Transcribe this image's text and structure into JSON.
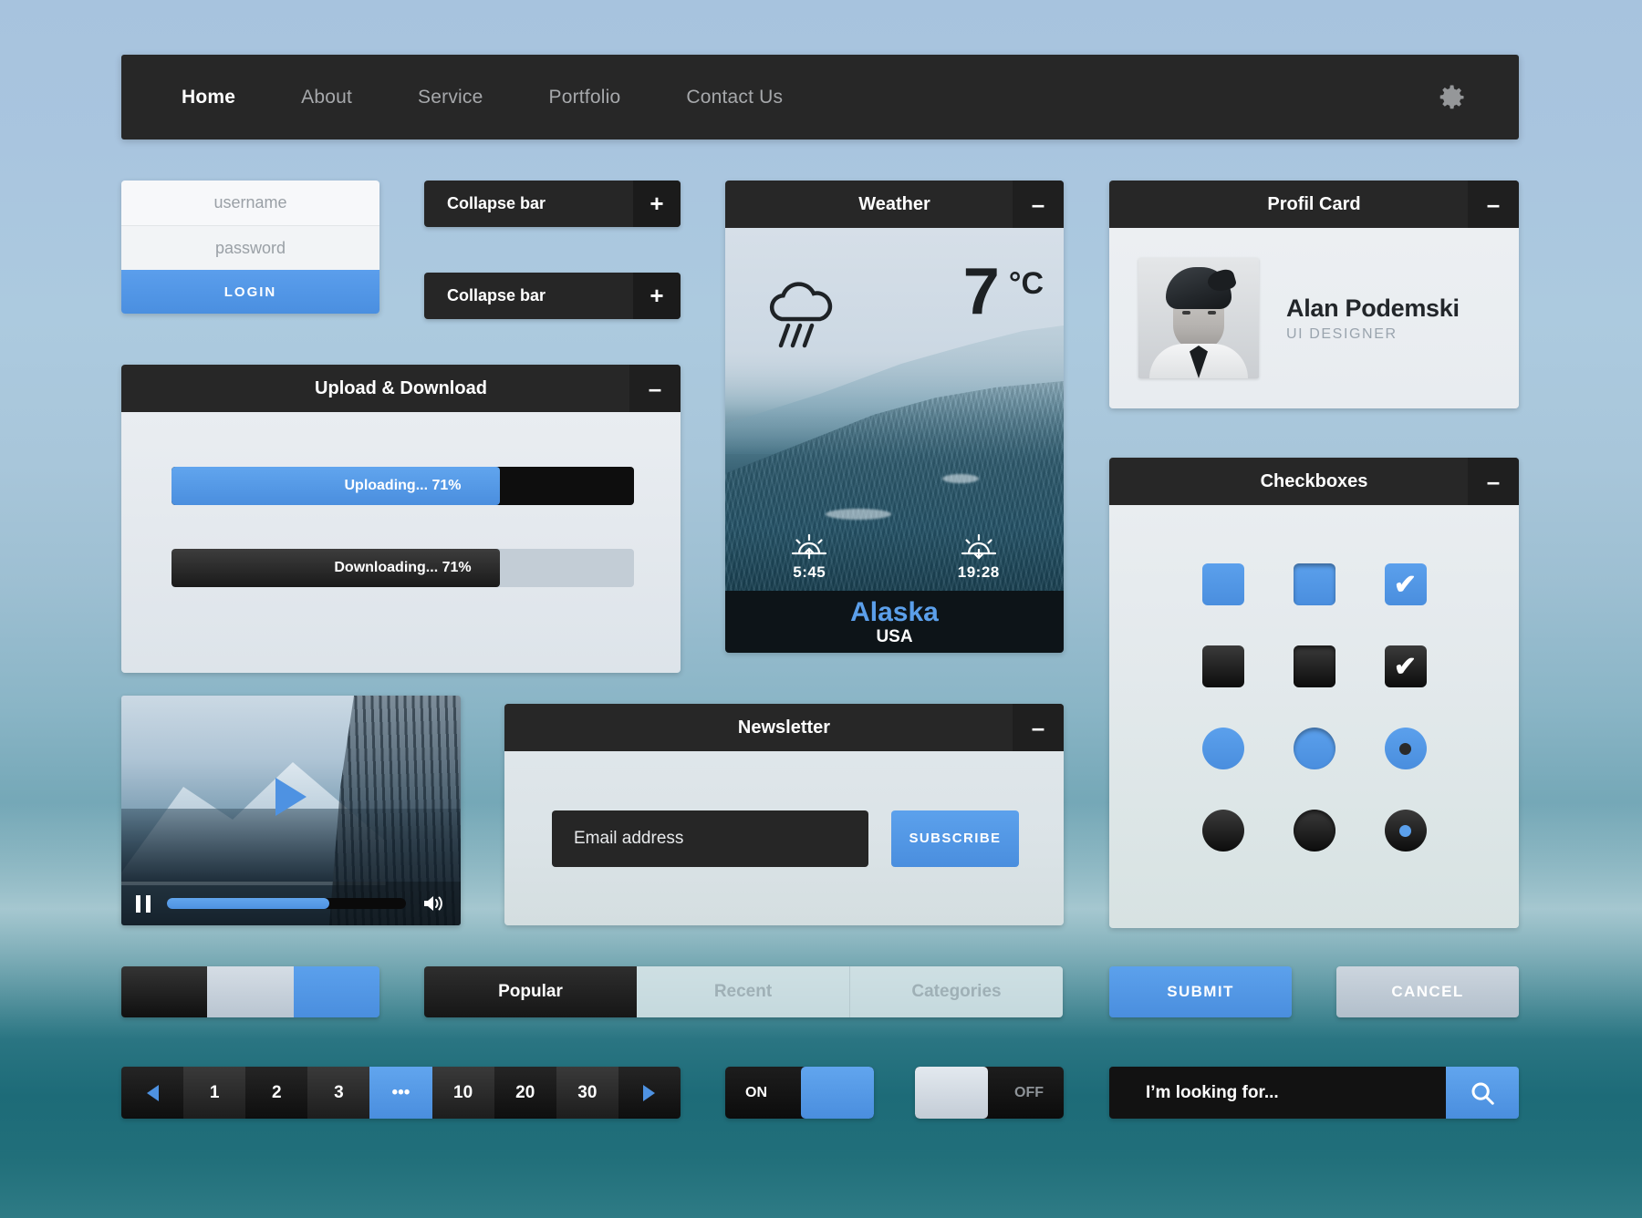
{
  "nav": {
    "items": [
      {
        "label": "Home",
        "active": true
      },
      {
        "label": "About",
        "active": false
      },
      {
        "label": "Service",
        "active": false
      },
      {
        "label": "Portfolio",
        "active": false
      },
      {
        "label": "Contact Us",
        "active": false
      }
    ],
    "settings_icon": "gear-icon"
  },
  "login": {
    "username_placeholder": "username",
    "password_placeholder": "password",
    "button_label": "LOGIN"
  },
  "collapse_bars": [
    {
      "label": "Collapse bar",
      "toggle": "+"
    },
    {
      "label": "Collapse bar",
      "toggle": "+"
    }
  ],
  "upload_download": {
    "title": "Upload & Download",
    "toggle": "–",
    "upload": {
      "label": "Uploading... 71%",
      "percent": 71
    },
    "download": {
      "label": "Downloading... 71%",
      "percent": 71
    }
  },
  "weather": {
    "title": "Weather",
    "toggle": "–",
    "condition_icon": "rain-cloud-icon",
    "temperature": "7",
    "unit": "°C",
    "sunrise": {
      "icon": "sunrise-icon",
      "time": "5:45"
    },
    "sunset": {
      "icon": "sunset-icon",
      "time": "19:28"
    },
    "place": "Alaska",
    "country": "USA"
  },
  "profile": {
    "title": "Profil Card",
    "toggle": "–",
    "name": "Alan Podemski",
    "role": "UI DESIGNER",
    "avatar_icon": "avatar"
  },
  "checkboxes": {
    "title": "Checkboxes",
    "toggle": "–",
    "items": [
      {
        "shape": "square",
        "style": "blue",
        "state": "empty"
      },
      {
        "shape": "square",
        "style": "blue",
        "state": "pressed"
      },
      {
        "shape": "square",
        "style": "blue",
        "state": "checked",
        "glyph": "✔"
      },
      {
        "shape": "square",
        "style": "dark",
        "state": "empty"
      },
      {
        "shape": "square",
        "style": "dark",
        "state": "pressed"
      },
      {
        "shape": "square",
        "style": "dark",
        "state": "checked",
        "glyph": "✔"
      },
      {
        "shape": "round",
        "style": "blue",
        "state": "empty"
      },
      {
        "shape": "round",
        "style": "blue",
        "state": "pressed"
      },
      {
        "shape": "round",
        "style": "blue",
        "state": "selected"
      },
      {
        "shape": "round",
        "style": "dark",
        "state": "empty"
      },
      {
        "shape": "round",
        "style": "dark",
        "state": "pressed"
      },
      {
        "shape": "round",
        "style": "dark",
        "state": "selected"
      }
    ]
  },
  "video": {
    "play_icon": "play-icon",
    "pause_icon": "pause-icon",
    "volume_icon": "volume-icon",
    "progress_percent": 68
  },
  "newsletter": {
    "title": "Newsletter",
    "toggle": "–",
    "email_placeholder": "Email address",
    "subscribe_label": "SUBSCRIBE"
  },
  "tabs": [
    {
      "label": "Popular",
      "active": true
    },
    {
      "label": "Recent",
      "active": false
    },
    {
      "label": "Categories",
      "active": false
    }
  ],
  "actions": {
    "submit_label": "SUBMIT",
    "cancel_label": "CANCEL"
  },
  "pagination": {
    "prev_icon": "triangle-left-icon",
    "next_icon": "triangle-right-icon",
    "pages": [
      "1",
      "2",
      "3",
      "•••",
      "10",
      "20",
      "30"
    ],
    "selected": "•••"
  },
  "toggles": [
    {
      "label": "ON",
      "state": "on"
    },
    {
      "label": "OFF",
      "state": "off"
    }
  ],
  "search": {
    "placeholder": "I’m looking for...",
    "icon": "search-icon"
  },
  "colors": {
    "accent_blue": "#4a8ede",
    "dark": "#272727",
    "panel_light": "#e6ebef"
  }
}
